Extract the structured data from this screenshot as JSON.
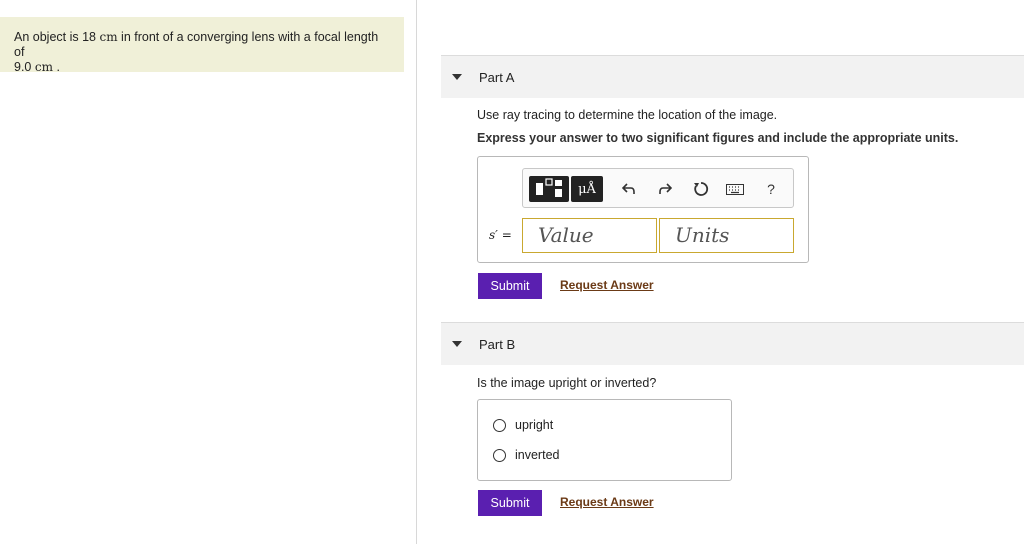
{
  "problem": {
    "text_before_1": "An object is 18 ",
    "unit_1": "cm",
    "text_after_1": " in front of a converging lens with a focal length of",
    "text_line2": "9.0 ",
    "unit_2": "cm",
    "text_end": " ."
  },
  "part_a": {
    "title": "Part A",
    "instruction": "Use ray tracing to determine the location of the image.",
    "express": "Express your answer to two significant figures and include the appropriate units.",
    "toolbar": {
      "template_icon": "template-icon",
      "mu_label": "μÅ",
      "undo_icon": "undo-icon",
      "redo_icon": "redo-icon",
      "reset_icon": "reset-icon",
      "keyboard_icon": "keyboard-icon",
      "help_label": "?"
    },
    "variable_label": "s′ =",
    "value_placeholder": "Value",
    "units_placeholder": "Units",
    "submit_label": "Submit",
    "request_label": "Request Answer"
  },
  "part_b": {
    "title": "Part B",
    "question": "Is the image upright or inverted?",
    "options": [
      "upright",
      "inverted"
    ],
    "submit_label": "Submit",
    "request_label": "Request Answer"
  }
}
